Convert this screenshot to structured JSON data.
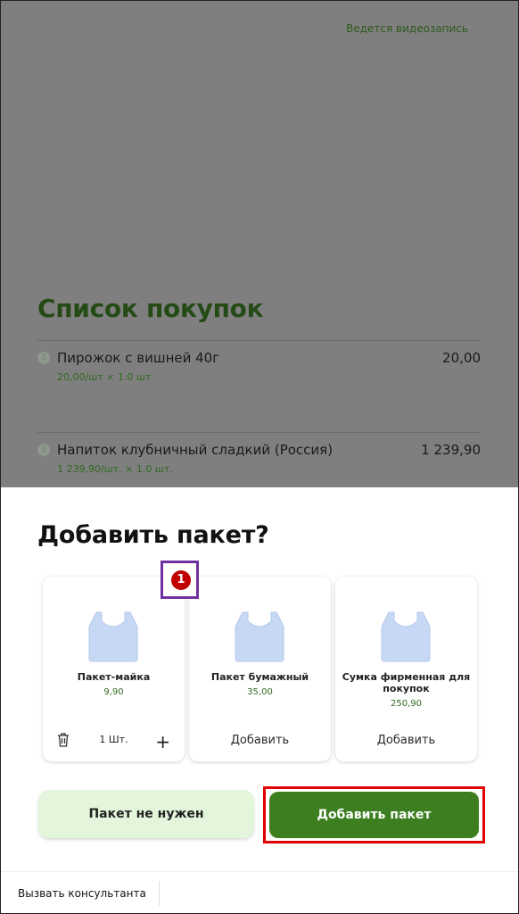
{
  "recording": "Ведется видеозапись",
  "cart": {
    "title": "Список покупок",
    "items": [
      {
        "num": "1",
        "name": "Пирожок с вишней 40г",
        "sub": "20,00/шт × 1.0 шт",
        "price": "20,00"
      },
      {
        "num": "2",
        "name": "Напиток клубничный сладкий (Россия)",
        "sub": "1 239,90/шт. × 1.0 шт.",
        "price": "1 239,90"
      }
    ]
  },
  "sheet": {
    "title": "Добавить пакет?",
    "bags": [
      {
        "name": "Пакет-майка",
        "price": "9,90",
        "qty": "1 Шт."
      },
      {
        "name": "Пакет бумажный",
        "price": "35,00",
        "action": "Добавить"
      },
      {
        "name": "Сумка фирменная для покупок",
        "price": "250,90",
        "action": "Добавить"
      }
    ],
    "annotation": "1",
    "no_bag_label": "Пакет не нужен",
    "add_bag_label": "Добавить пакет"
  },
  "footer": {
    "consult_label": "Вызвать консультанта"
  },
  "colors": {
    "accent": "#3d7f20",
    "light_accent": "#e3f6dc",
    "highlight": "#e00000",
    "annotation": "#7030a0"
  }
}
